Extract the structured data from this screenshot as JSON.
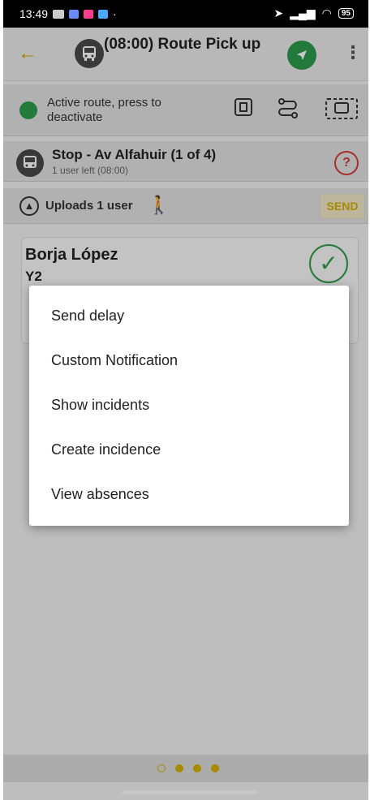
{
  "status_bar": {
    "time": "13:49",
    "battery": "95"
  },
  "app_bar": {
    "title": "(08:00) Route Pick up",
    "back_icon": "arrow-left-icon",
    "navigate_icon": "navigation-arrow-icon",
    "more_icon": "more-vert-icon"
  },
  "route_bar": {
    "status_text": "Active route, press to deactivate",
    "status_color": "#2f9e49"
  },
  "stop": {
    "title": "Stop - Av Alfahuir  (1 of 4)",
    "subtitle": "1 user left (08:00)"
  },
  "uploads": {
    "label": "Uploads 1 user",
    "send_label": "SEND"
  },
  "user_card": {
    "name": "Borja López",
    "group": "Y2"
  },
  "menu": {
    "items": [
      {
        "label": "Send delay"
      },
      {
        "label": "Custom Notification"
      },
      {
        "label": "Show incidents"
      },
      {
        "label": "Create incidence"
      },
      {
        "label": "View absences"
      }
    ]
  },
  "pager": {
    "total_pages": 4,
    "current_page": 1
  },
  "colors": {
    "accent": "#d7b100",
    "active_green": "#2f9e49",
    "alert_red": "#d63b3b"
  }
}
